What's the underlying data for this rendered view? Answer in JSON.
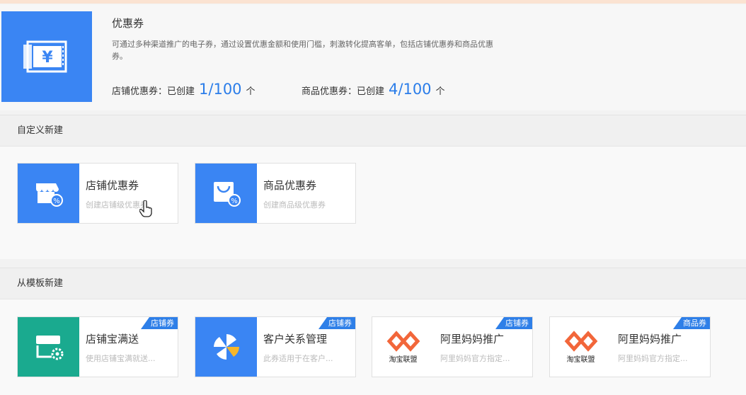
{
  "header": {
    "title": "优惠券",
    "description": "可通过多种渠道推广的电子券，通过设置优惠金额和使用门槛，刺激转化提高客单，包括店铺优惠券和商品优惠券。",
    "stats": [
      {
        "label": "店铺优惠券：已创建",
        "value": "1/100",
        "unit": "个"
      },
      {
        "label": "商品优惠券：已创建",
        "value": "4/100",
        "unit": "个"
      }
    ]
  },
  "custom": {
    "title": "自定义新建",
    "cards": [
      {
        "name": "店铺优惠券",
        "sub": "创建店铺级优惠券",
        "icon": "store-coupon-icon"
      },
      {
        "name": "商品优惠券",
        "sub": "创建商品级优惠券",
        "icon": "bag-coupon-icon"
      }
    ]
  },
  "template": {
    "title": "从模板新建",
    "cards": [
      {
        "name": "店铺宝满送",
        "sub": "使用店铺宝满就送...",
        "tag": "店铺券",
        "icon": "shop-gear-icon"
      },
      {
        "name": "客户关系管理",
        "sub": "此券适用于在客户...",
        "tag": "店铺券",
        "icon": "pinwheel-icon"
      },
      {
        "name": "阿里妈妈推广",
        "sub": "阿里妈妈官方指定...",
        "tag": "店铺券",
        "icon": "taobao-union-logo",
        "logo_text": "淘宝联盟"
      },
      {
        "name": "阿里妈妈推广",
        "sub": "阿里妈妈官方指定...",
        "tag": "商品券",
        "icon": "taobao-union-logo",
        "logo_text": "淘宝联盟"
      }
    ]
  },
  "colors": {
    "brand_blue": "#3a85f3",
    "number_blue": "#2b7de9",
    "teal": "#1aaa8f",
    "logo_orange": "#f2663a"
  }
}
